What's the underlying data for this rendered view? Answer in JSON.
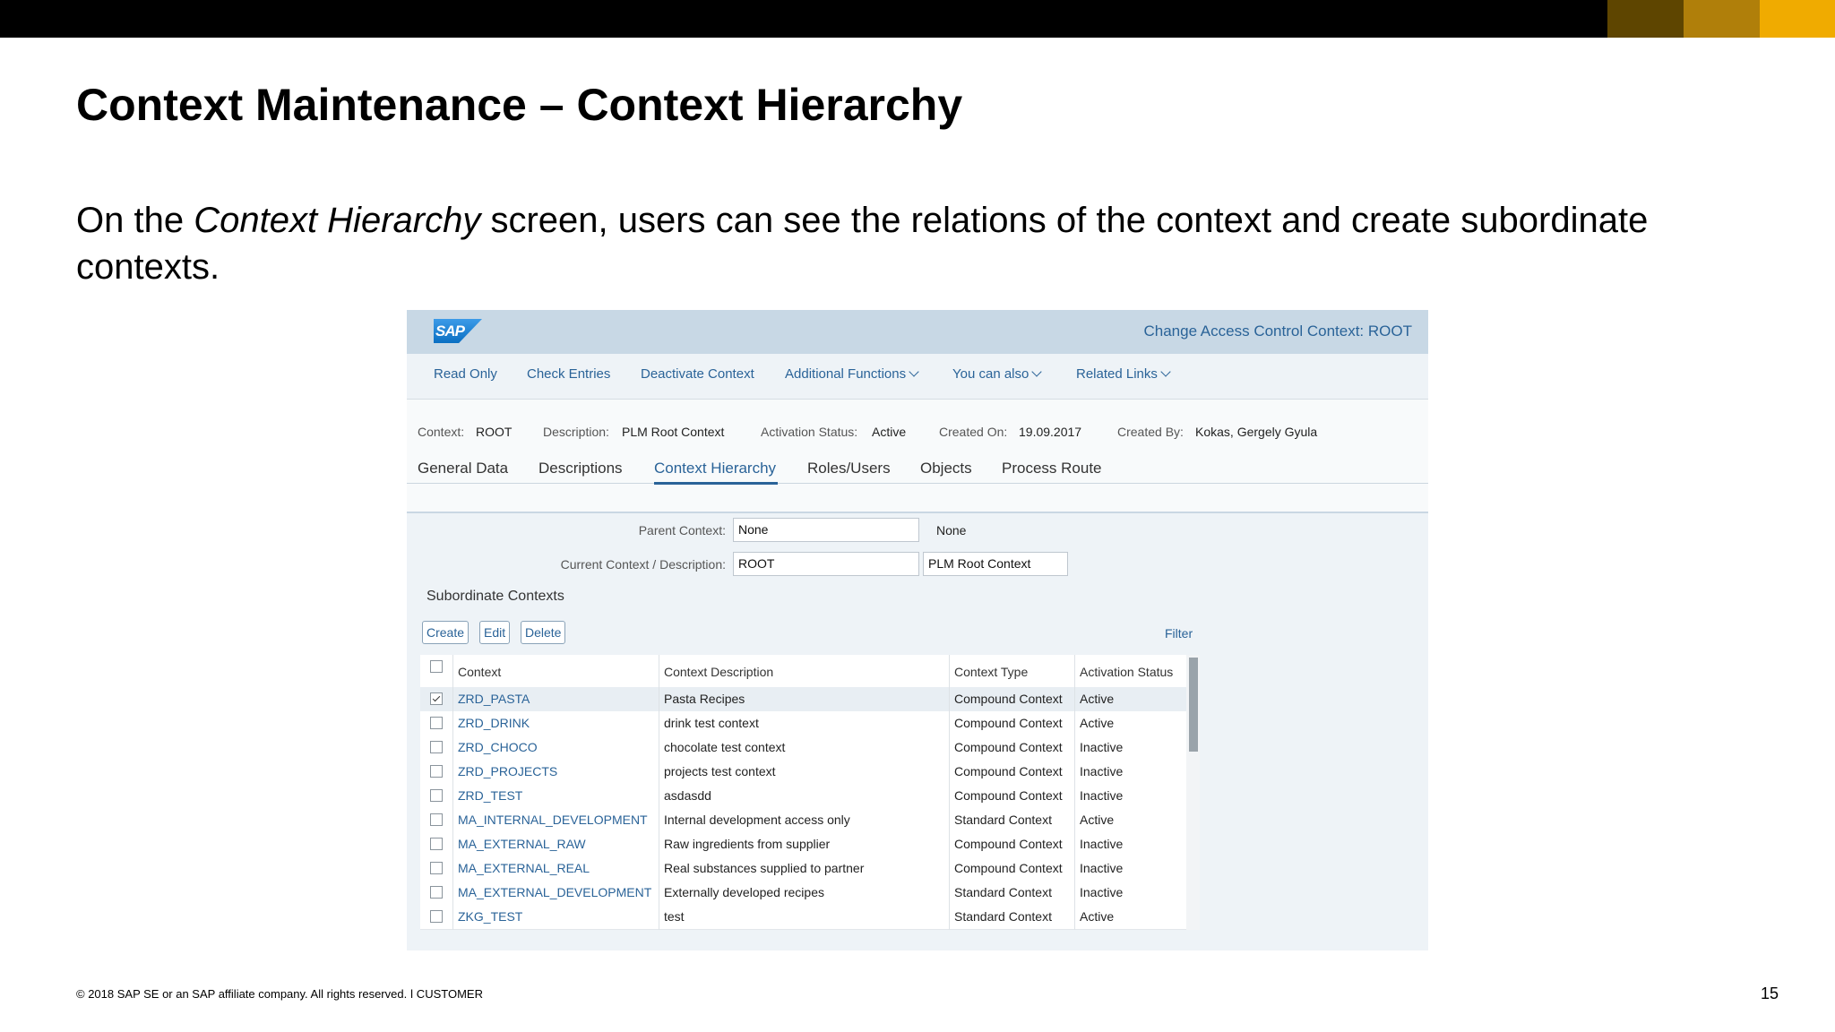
{
  "slide": {
    "title": "Context Maintenance – Context Hierarchy",
    "body_pre": "On the ",
    "body_em": "Context Hierarchy",
    "body_post": " screen, users can see the relations of the context and create subordinate contexts.",
    "footer": "© 2018 SAP SE or an SAP affiliate company. All rights reserved.   ǀ   CUSTOMER",
    "page_number": "15"
  },
  "app": {
    "logo": "SAP",
    "window_title": "Change Access Control Context: ROOT",
    "toolbar": {
      "read_only": "Read Only",
      "check_entries": "Check Entries",
      "deactivate_context": "Deactivate Context",
      "additional_functions": "Additional Functions",
      "you_can_also": "You can also",
      "related_links": "Related Links"
    },
    "info": {
      "context_label": "Context:",
      "context_value": "ROOT",
      "description_label": "Description:",
      "description_value": "PLM Root Context",
      "activation_label": "Activation Status:",
      "activation_value": "Active",
      "created_on_label": "Created On:",
      "created_on_value": "19.09.2017",
      "created_by_label": "Created By:",
      "created_by_value": "Kokas, Gergely Gyula"
    },
    "tabs": {
      "general_data": "General Data",
      "descriptions": "Descriptions",
      "context_hierarchy": "Context Hierarchy",
      "roles_users": "Roles/Users",
      "objects": "Objects",
      "process_route": "Process Route"
    },
    "form": {
      "parent_label": "Parent Context:",
      "parent_value": "None",
      "parent_desc": "None",
      "current_label": "Current Context / Description:",
      "current_value": "ROOT",
      "current_desc": "PLM Root Context"
    },
    "subordinate": {
      "title": "Subordinate Contexts",
      "create": "Create",
      "edit": "Edit",
      "delete": "Delete",
      "filter": "Filter",
      "columns": {
        "context": "Context",
        "description": "Context Description",
        "type": "Context Type",
        "status": "Activation Status"
      },
      "rows": [
        {
          "context": "ZRD_PASTA",
          "description": "Pasta Recipes",
          "type": "Compound Context",
          "status": "Active",
          "checked": true
        },
        {
          "context": "ZRD_DRINK",
          "description": "drink test context",
          "type": "Compound Context",
          "status": "Active",
          "checked": false
        },
        {
          "context": "ZRD_CHOCO",
          "description": "chocolate test context",
          "type": "Compound Context",
          "status": "Inactive",
          "checked": false
        },
        {
          "context": "ZRD_PROJECTS",
          "description": "projects test context",
          "type": "Compound Context",
          "status": "Inactive",
          "checked": false
        },
        {
          "context": "ZRD_TEST",
          "description": "asdasdd",
          "type": "Compound Context",
          "status": "Inactive",
          "checked": false
        },
        {
          "context": "MA_INTERNAL_DEVELOPMENT",
          "description": "Internal development access only",
          "type": "Standard Context",
          "status": "Active",
          "checked": false
        },
        {
          "context": "MA_EXTERNAL_RAW",
          "description": "Raw ingredients from supplier",
          "type": "Compound Context",
          "status": "Inactive",
          "checked": false
        },
        {
          "context": "MA_EXTERNAL_REAL",
          "description": "Real substances supplied to partner",
          "type": "Compound Context",
          "status": "Inactive",
          "checked": false
        },
        {
          "context": "MA_EXTERNAL_DEVELOPMENT",
          "description": "Externally developed recipes",
          "type": "Standard Context",
          "status": "Inactive",
          "checked": false
        },
        {
          "context": "ZKG_TEST",
          "description": "test",
          "type": "Standard Context",
          "status": "Active",
          "checked": false
        }
      ]
    }
  }
}
